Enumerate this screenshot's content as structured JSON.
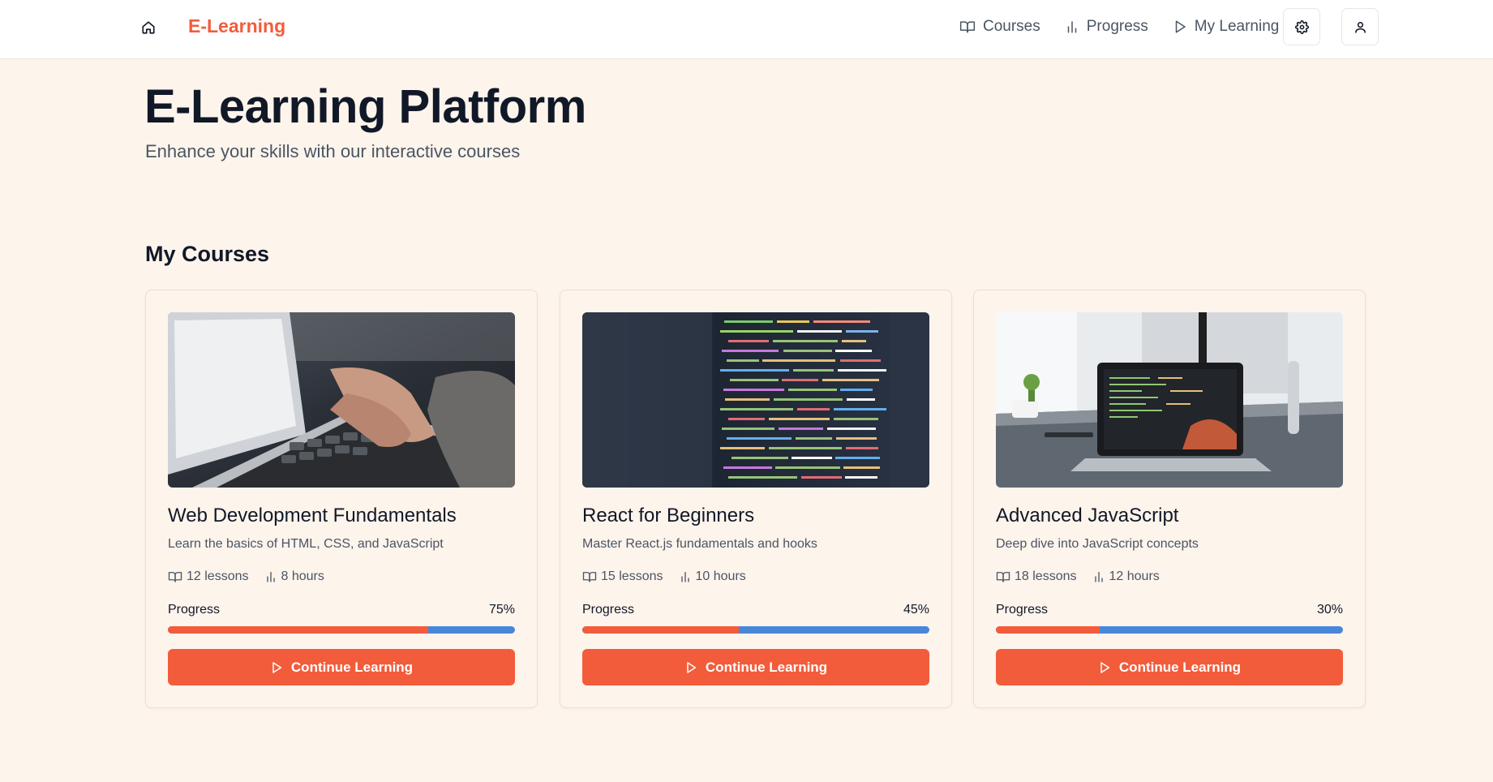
{
  "header": {
    "brand": "E-Learning",
    "nav": [
      {
        "label": "Courses",
        "icon": "book-icon"
      },
      {
        "label": "Progress",
        "icon": "bar-chart-icon"
      },
      {
        "label": "My Learning",
        "icon": "play-icon"
      }
    ],
    "actions": [
      "settings-icon",
      "user-icon"
    ]
  },
  "hero": {
    "title": "E-Learning Platform",
    "subtitle": "Enhance your skills with our interactive courses"
  },
  "section": {
    "title": "My Courses"
  },
  "courses": [
    {
      "title": "Web Development Fundamentals",
      "description": "Learn the basics of HTML, CSS, and JavaScript",
      "lessons": "12 lessons",
      "hours": "8 hours",
      "progress_label": "Progress",
      "progress_text": "75%",
      "progress": 0.75,
      "cta": "Continue Learning",
      "image": "laptop-typing-photo"
    },
    {
      "title": "React for Beginners",
      "description": "Master React.js fundamentals and hooks",
      "lessons": "15 lessons",
      "hours": "10 hours",
      "progress_label": "Progress",
      "progress_text": "45%",
      "progress": 0.45,
      "cta": "Continue Learning",
      "image": "code-screen-photo"
    },
    {
      "title": "Advanced JavaScript",
      "description": "Deep dive into JavaScript concepts",
      "lessons": "18 lessons",
      "hours": "12 hours",
      "progress_label": "Progress",
      "progress_text": "30%",
      "progress": 0.3,
      "cta": "Continue Learning",
      "image": "desk-laptop-photo"
    }
  ],
  "colors": {
    "accent": "#f25c3b",
    "progress_remaining": "#4a86d8",
    "background": "#fdf4ec"
  }
}
